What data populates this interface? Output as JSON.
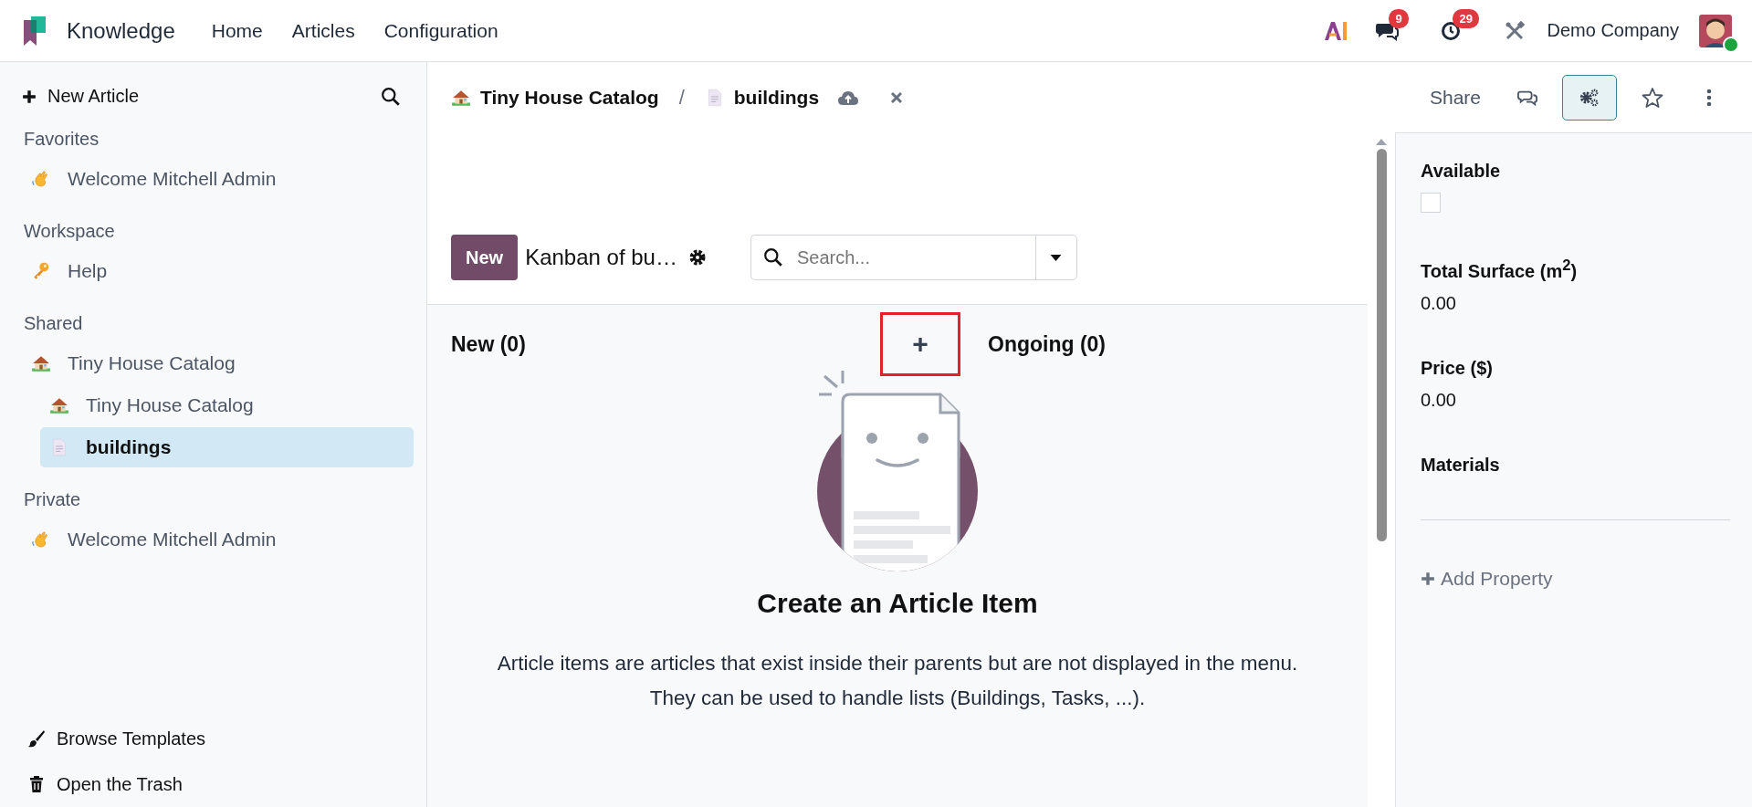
{
  "navbar": {
    "app_name": "Knowledge",
    "menu": [
      "Home",
      "Articles",
      "Configuration"
    ],
    "messages_badge": "9",
    "activities_badge": "29",
    "company": "Demo Company",
    "user_online": true
  },
  "sidebar": {
    "new_article": "New Article",
    "sections": [
      {
        "title": "Favorites",
        "items": [
          {
            "kind": "hand",
            "label": "Welcome Mitchell Admin",
            "selected": false
          }
        ]
      },
      {
        "title": "Workspace",
        "items": [
          {
            "kind": "key",
            "label": "Help",
            "selected": false
          }
        ]
      },
      {
        "title": "Shared",
        "items": [
          {
            "kind": "house",
            "label": "Tiny House Catalog",
            "selected": false,
            "children": [
              {
                "kind": "house",
                "label": "Tiny House Catalog",
                "selected": false
              },
              {
                "kind": "page",
                "label": "buildings",
                "selected": true
              }
            ]
          }
        ]
      },
      {
        "title": "Private",
        "items": [
          {
            "kind": "hand",
            "label": "Welcome Mitchell Admin",
            "selected": false
          }
        ]
      }
    ],
    "footer": [
      {
        "kind": "brush",
        "label": "Browse Templates"
      },
      {
        "kind": "trash",
        "label": "Open the Trash"
      }
    ]
  },
  "header": {
    "breadcrumb_separator": "/",
    "breadcrumb": [
      {
        "kind": "house",
        "label": "Tiny House Catalog"
      },
      {
        "kind": "page",
        "label": "buildings"
      }
    ],
    "actions": [
      {
        "kind": "share",
        "label": "Share",
        "selected": false
      },
      {
        "kind": "chat",
        "selected": false
      },
      {
        "kind": "properties",
        "selected": true
      },
      {
        "kind": "star",
        "selected": false
      },
      {
        "kind": "more",
        "selected": false
      }
    ]
  },
  "kanban": {
    "new_button": "New",
    "title": "Kanban of bu…",
    "search_placeholder": "Search...",
    "columns": [
      {
        "title": "New (0)",
        "quick_add": "+",
        "highlighted": true
      },
      {
        "title": "Ongoing (0)"
      }
    ]
  },
  "empty_state": {
    "title": "Create an Article Item",
    "text": "Article items are articles that exist inside their parents but are not displayed in the menu. They can be used to handle lists (Buildings, Tasks, ...)."
  },
  "properties": {
    "items": [
      {
        "kind": "checkbox",
        "label": "Available",
        "checked": false
      },
      {
        "kind": "value",
        "label": "Total Surface (m$^{2}$)",
        "value": "0.00"
      },
      {
        "kind": "value",
        "label": "Price ($)",
        "value": "0.00"
      },
      {
        "kind": "value",
        "label": "Materials"
      }
    ],
    "add_label": "Add Property"
  }
}
